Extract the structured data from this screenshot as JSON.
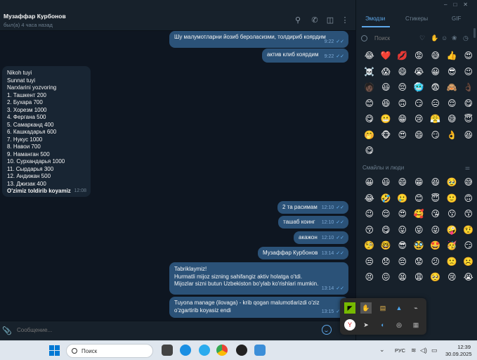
{
  "header": {
    "contact_name": "Музаффар Курбонов",
    "status": "был(а) 4 часа назад"
  },
  "messages": [
    {
      "dir": "out",
      "text": "Шу малумотларни йозиб бероласизми, толдириб коярдим",
      "time": "9:22"
    },
    {
      "dir": "out",
      "text": "актив клиб коярдим",
      "time": "9:22"
    },
    {
      "dir": "in",
      "lines": [
        "Nikoh tuyi",
        "Sunnat tuyi",
        "Narxlarini yozvoring",
        "1. Ташкент 200",
        "2. Бухара 700",
        "3. Хорезм 1000",
        "4. Фергана 500",
        "5. Самарканд 400",
        "6. Кашкадарья 600",
        "7. Нукус 1000",
        "8. Навои 700",
        "9. Наманган 500",
        "10. Сурхандарья 1000",
        "11. Сырдарья 300",
        "12. Андижан 500",
        "13. Джизак 400",
        "O'zimiz toldirib koyamiz"
      ],
      "time": "12:08"
    },
    {
      "dir": "out",
      "text": "2 та расимам",
      "time": "12:10"
    },
    {
      "dir": "out",
      "text": "ташаб коинг",
      "time": "12:10"
    },
    {
      "dir": "out",
      "text": "акажон",
      "time": "12:10"
    },
    {
      "dir": "out",
      "text": "Музаффар Курбонов",
      "time": "13:14"
    },
    {
      "dir": "out",
      "lines": [
        "Tabriklaymiz!",
        "Hurmatli mijoz sizning sahifangiz aktiv holatga o'tdi.",
        "Mijozlar sizni butun Uzbekiston bo'ylab ko'rishlari mumkin."
      ],
      "time": "13:14"
    },
    {
      "dir": "out",
      "lines": [
        "Tuyona manage (ilovaga) - krib qogan malumotlarizdi o'ziz",
        "o'zgartirib koyasiz endi"
      ],
      "time": "13:15"
    }
  ],
  "composer": {
    "placeholder": "Сообщение..."
  },
  "panel": {
    "tabs": [
      "Эмодзи",
      "Стикеры",
      "GIF"
    ],
    "search_placeholder": "Поиск",
    "category_icons": [
      "heart-icon",
      "thumb-icon",
      "like-icon",
      "smile-icon",
      "cat-icon",
      "ball-icon",
      "building-icon"
    ],
    "recent": [
      "😂",
      "❤️",
      "💋",
      "😡",
      "😅",
      "👍",
      "😍",
      "☠️",
      "😱",
      "😄",
      "😭",
      "😀",
      "😎",
      "😉",
      "🧑🏿",
      "😃",
      "😔",
      "🥶",
      "😨",
      "🙈",
      "👌🏿",
      "😊",
      "😆",
      "🙃",
      "😏",
      "😑",
      "😌",
      "😋",
      "😋",
      "😬",
      "😁",
      "😢",
      "😤",
      "😅",
      "😇",
      "🤭",
      "🐵",
      "😍",
      "😄",
      "😏",
      "👌",
      "😆",
      "😋"
    ],
    "section_title": "Смайлы и люди",
    "people": [
      "😀",
      "😃",
      "😄",
      "😁",
      "😆",
      "🥹",
      "😅",
      "😂",
      "🤣",
      "🥲",
      "😊",
      "😇",
      "🙂",
      "🙃",
      "😉",
      "😌",
      "😍",
      "🥰",
      "😘",
      "😗",
      "😙",
      "😚",
      "😋",
      "😛",
      "😝",
      "😜",
      "🤪",
      "🤨",
      "🧐",
      "🤓",
      "😎",
      "🥸",
      "🤩",
      "🥳",
      "😏",
      "😒",
      "😞",
      "😔",
      "😟",
      "😕",
      "🙁",
      "☹️",
      "😣",
      "😖",
      "😫",
      "😩",
      "🥺",
      "😢",
      "😭",
      "😤",
      "😠",
      "😡",
      "🤬",
      "🤯",
      "😳",
      "🥵",
      "🥶",
      "😱"
    ]
  },
  "tray_popup": {
    "icons": [
      "nvidia-icon",
      "hand-icon",
      "stack-icon",
      "drive-icon",
      "usb-icon",
      "yandex-icon",
      "telegram-icon",
      "palette-icon",
      "gamepad-icon",
      "grid-icon"
    ]
  },
  "taskbar": {
    "search_text": "Поиск",
    "lang": "РУС",
    "time": "12:39",
    "date": "30.09.2025",
    "badge_telegram": "86"
  },
  "colors": {
    "accent": "#5ea7e8",
    "outgoing": "#2b5278",
    "incoming": "#182533",
    "background": "#0e1621"
  }
}
